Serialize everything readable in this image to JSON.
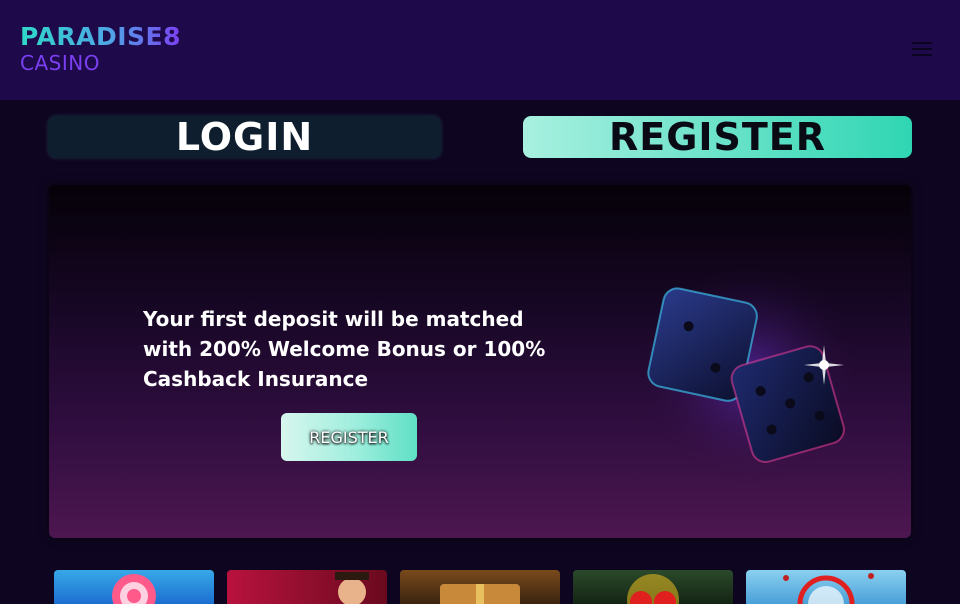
{
  "brand": {
    "name": "PARADISE8",
    "tagline": "CASINO"
  },
  "header": {
    "menu_icon": "hamburger-menu-icon"
  },
  "auth": {
    "login_label": "LOGIN",
    "register_label": "REGISTER"
  },
  "promo": {
    "text": "Your first deposit will be matched with 200% Welcome Bonus or 100% Cashback Insurance",
    "cta_label": "REGISTER",
    "art_icon": "dice-icon"
  },
  "games": [
    {
      "icon": "candy-lollipop-icon"
    },
    {
      "icon": "character-portrait-icon"
    },
    {
      "icon": "treasure-chest-icon"
    },
    {
      "icon": "fruit-slot-icon"
    },
    {
      "icon": "ocean-game-icon"
    }
  ],
  "colors": {
    "header_bg": "#1e0a4a",
    "page_bg": "#0e0620",
    "accent_teal": "#2fd6b3",
    "accent_purple": "#7b3ff2"
  }
}
